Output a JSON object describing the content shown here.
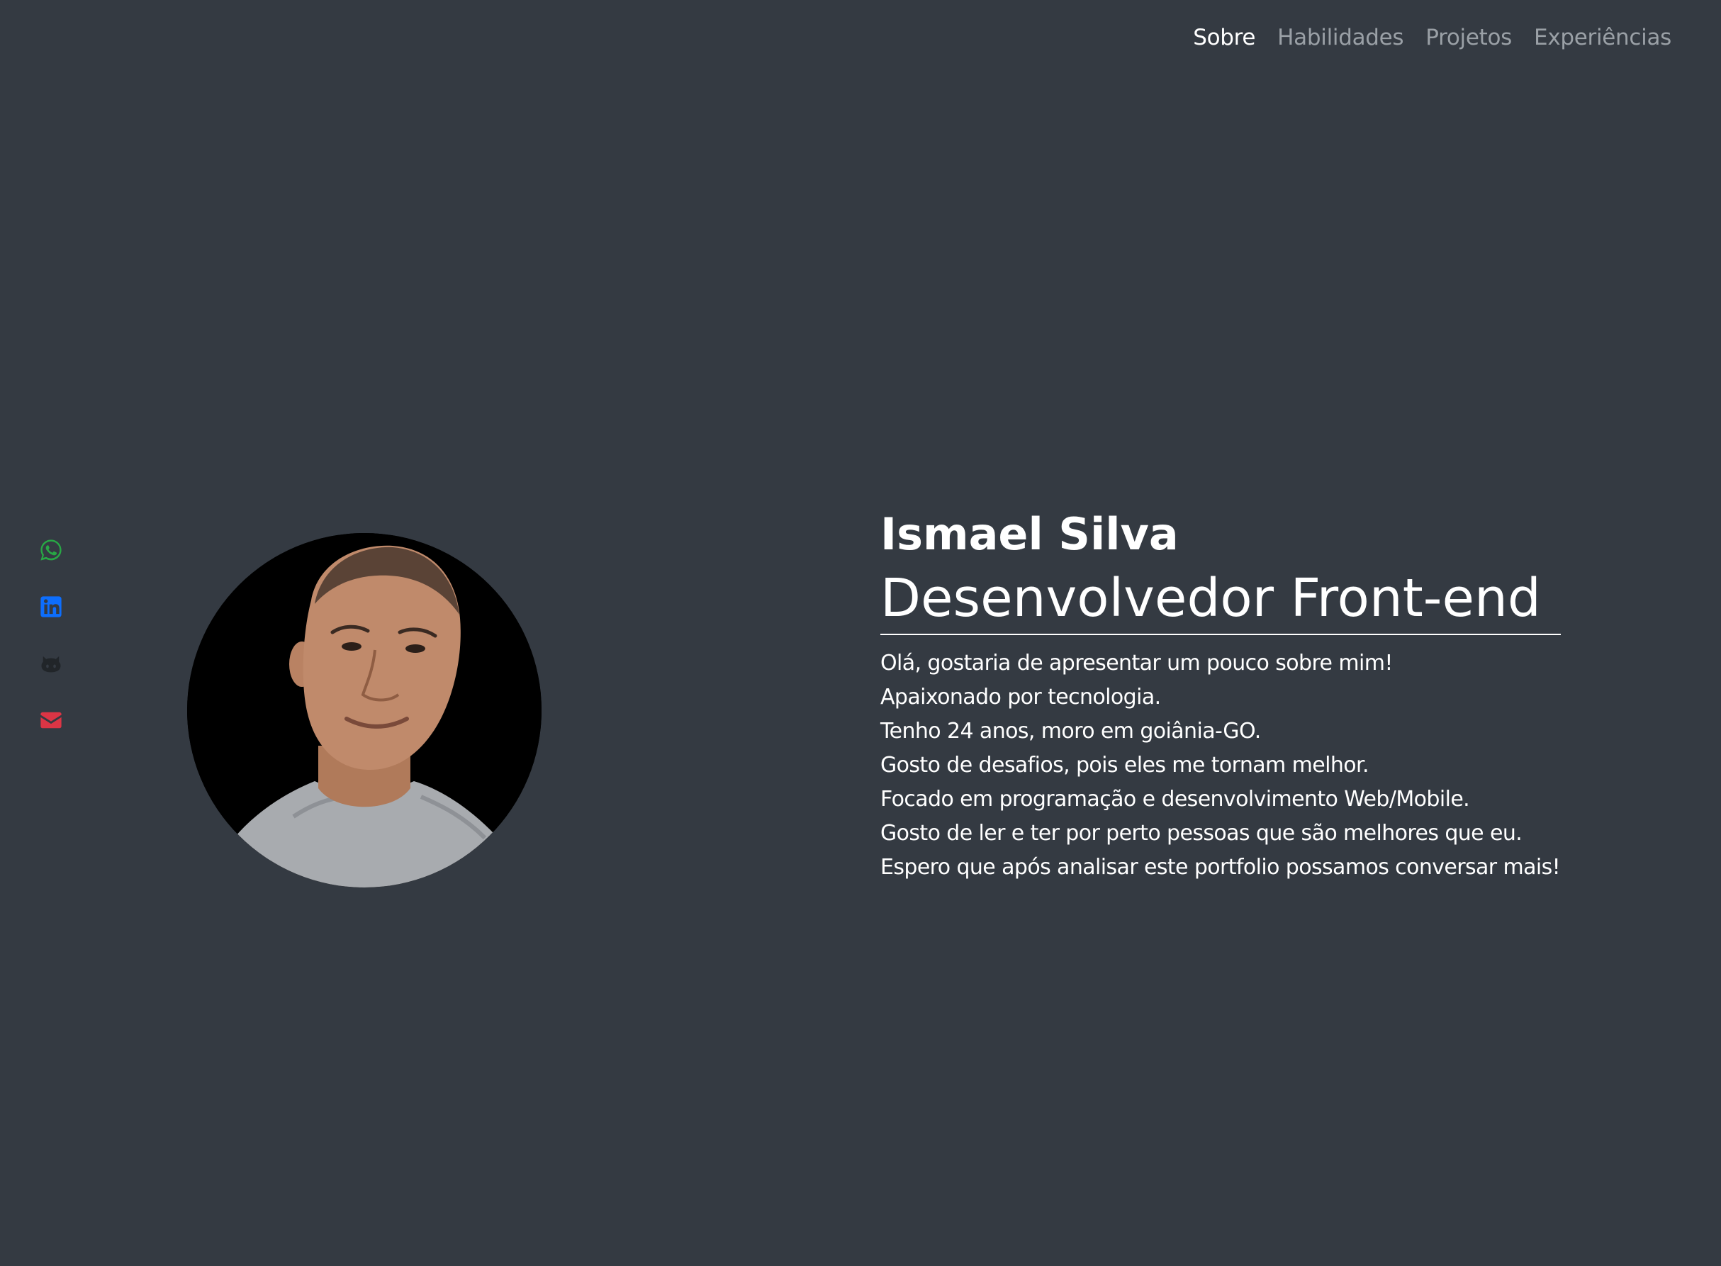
{
  "nav": {
    "items": [
      {
        "label": "Sobre",
        "active": true
      },
      {
        "label": "Habilidades",
        "active": false
      },
      {
        "label": "Projetos",
        "active": false
      },
      {
        "label": "Experiências",
        "active": false
      }
    ]
  },
  "social": [
    {
      "icon": "whatsapp-icon",
      "color": "#28a745"
    },
    {
      "icon": "linkedin-icon",
      "color": "#0d6efd"
    },
    {
      "icon": "github-icon",
      "color": "#212529"
    },
    {
      "icon": "envelope-icon",
      "color": "#dc3545"
    }
  ],
  "profile": {
    "name": "Ismael Silva",
    "role": "Desenvolvedor Front-end",
    "bio": [
      "Olá, gostaria de apresentar um pouco sobre mim!",
      "Apaixonado por tecnologia.",
      "Tenho 24 anos, moro em goiânia-GO.",
      "Gosto de desafios, pois eles me tornam melhor.",
      "Focado em programação e desenvolvimento Web/Mobile.",
      "Gosto de ler e ter por perto pessoas que são melhores que eu.",
      "Espero que após analisar este portfolio possamos conversar mais!"
    ]
  },
  "colors": {
    "background": "#343a42",
    "nav_inactive": "#9aa0a6",
    "nav_active": "#ffffff",
    "text": "#ffffff"
  }
}
